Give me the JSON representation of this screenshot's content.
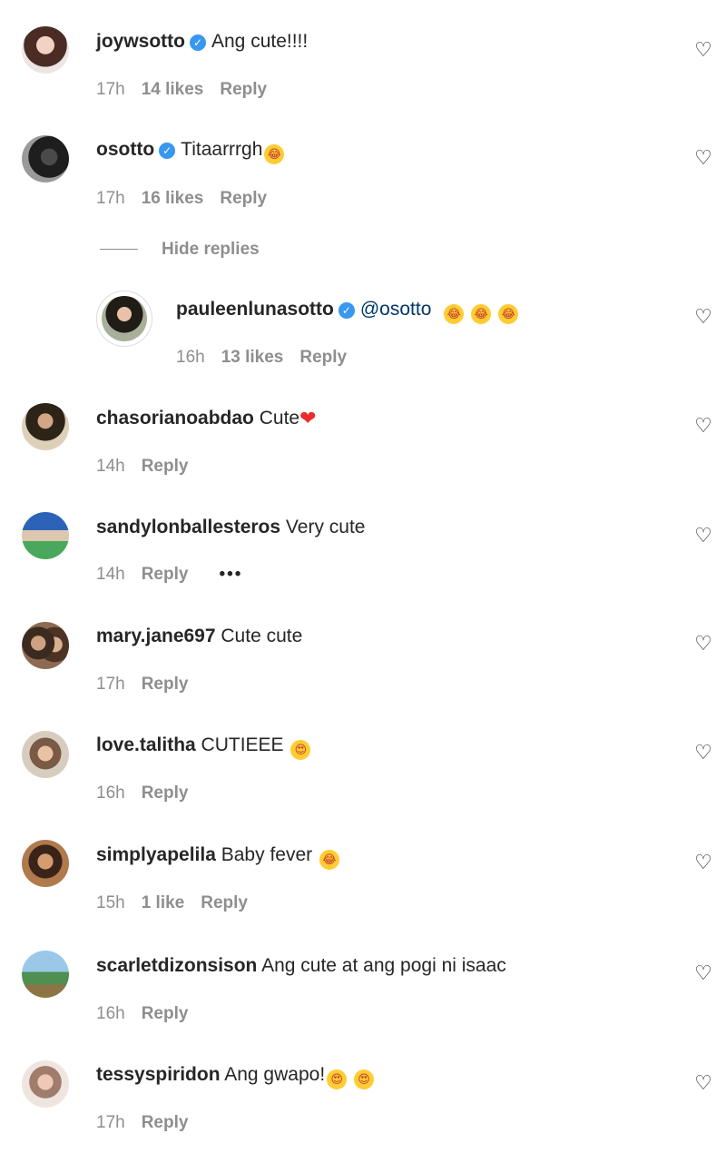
{
  "comments": [
    {
      "user": "joywsotto",
      "verified": true,
      "text": "Ang cute!!!!",
      "time": "17h",
      "likes": "14 likes",
      "reply": "Reply"
    },
    {
      "user": "osotto",
      "verified": true,
      "text": "Titaarrrgh",
      "time": "17h",
      "likes": "16 likes",
      "reply": "Reply"
    },
    {
      "user": "chasorianoabdao",
      "verified": false,
      "text": "Cute",
      "time": "14h",
      "reply": "Reply"
    },
    {
      "user": "sandylonballesteros",
      "verified": false,
      "text": "Very cute",
      "time": "14h",
      "reply": "Reply",
      "more": "•••"
    },
    {
      "user": "mary.jane697",
      "verified": false,
      "text": "Cute cute",
      "time": "17h",
      "reply": "Reply"
    },
    {
      "user": "love.talitha",
      "verified": false,
      "text": "CUTIEEE",
      "time": "16h",
      "reply": "Reply"
    },
    {
      "user": "simplyapelila",
      "verified": false,
      "text": "Baby fever",
      "time": "15h",
      "likes": "1 like",
      "reply": "Reply"
    },
    {
      "user": "scarletdizonsison",
      "verified": false,
      "text": "Ang cute at ang pogi ni isaac",
      "time": "16h",
      "reply": "Reply"
    },
    {
      "user": "tessyspiridon",
      "verified": false,
      "text": "Ang gwapo!",
      "time": "17h",
      "reply": "Reply"
    }
  ],
  "hide_replies": "Hide replies",
  "reply_comment": {
    "user": "pauleenlunasotto",
    "verified": true,
    "text": "@osotto",
    "time": "16h",
    "likes": "13 likes",
    "reply": "Reply"
  },
  "icons": {
    "verified": "✓",
    "like": "♡",
    "heart": "❤",
    "laugh": "😂",
    "heart_eyes": "😍"
  },
  "colors": {
    "text": "#262626",
    "meta": "#8e8e8e",
    "verified": "#3897f0",
    "heart": "#ed2b2b"
  }
}
